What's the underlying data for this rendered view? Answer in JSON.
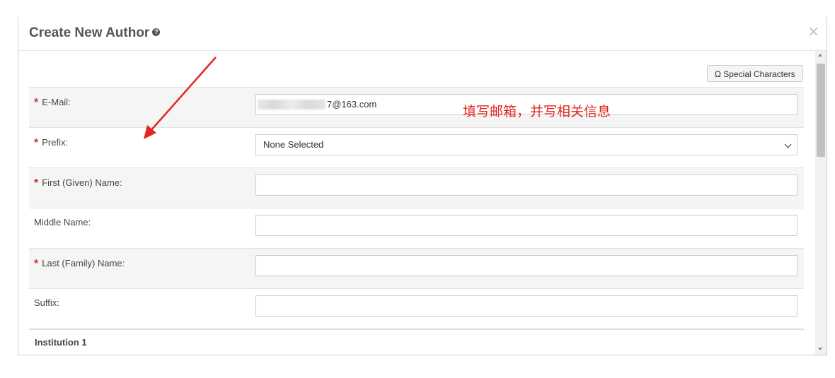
{
  "modal": {
    "title": "Create New Author",
    "help_icon": "?",
    "close_icon": "×",
    "special_characters_label": "Ω Special Characters"
  },
  "form": {
    "email": {
      "label": "E-Mail:",
      "value": "7@163.com",
      "required": true
    },
    "prefix": {
      "label": "Prefix:",
      "value": "None Selected",
      "required": true
    },
    "first_name": {
      "label": "First (Given) Name:",
      "value": "",
      "required": true
    },
    "middle_name": {
      "label": "Middle Name:",
      "value": "",
      "required": false
    },
    "last_name": {
      "label": "Last (Family) Name:",
      "value": "",
      "required": true
    },
    "suffix": {
      "label": "Suffix:",
      "value": "",
      "required": false
    }
  },
  "required_marker": "*",
  "section": {
    "institution_title": "Institution 1"
  },
  "annotation": {
    "text": "填写邮箱，并写相关信息",
    "color": "#e3261f"
  },
  "icons": [
    "help-icon",
    "close-icon",
    "chevron-down-icon",
    "red-arrow-annotation"
  ]
}
